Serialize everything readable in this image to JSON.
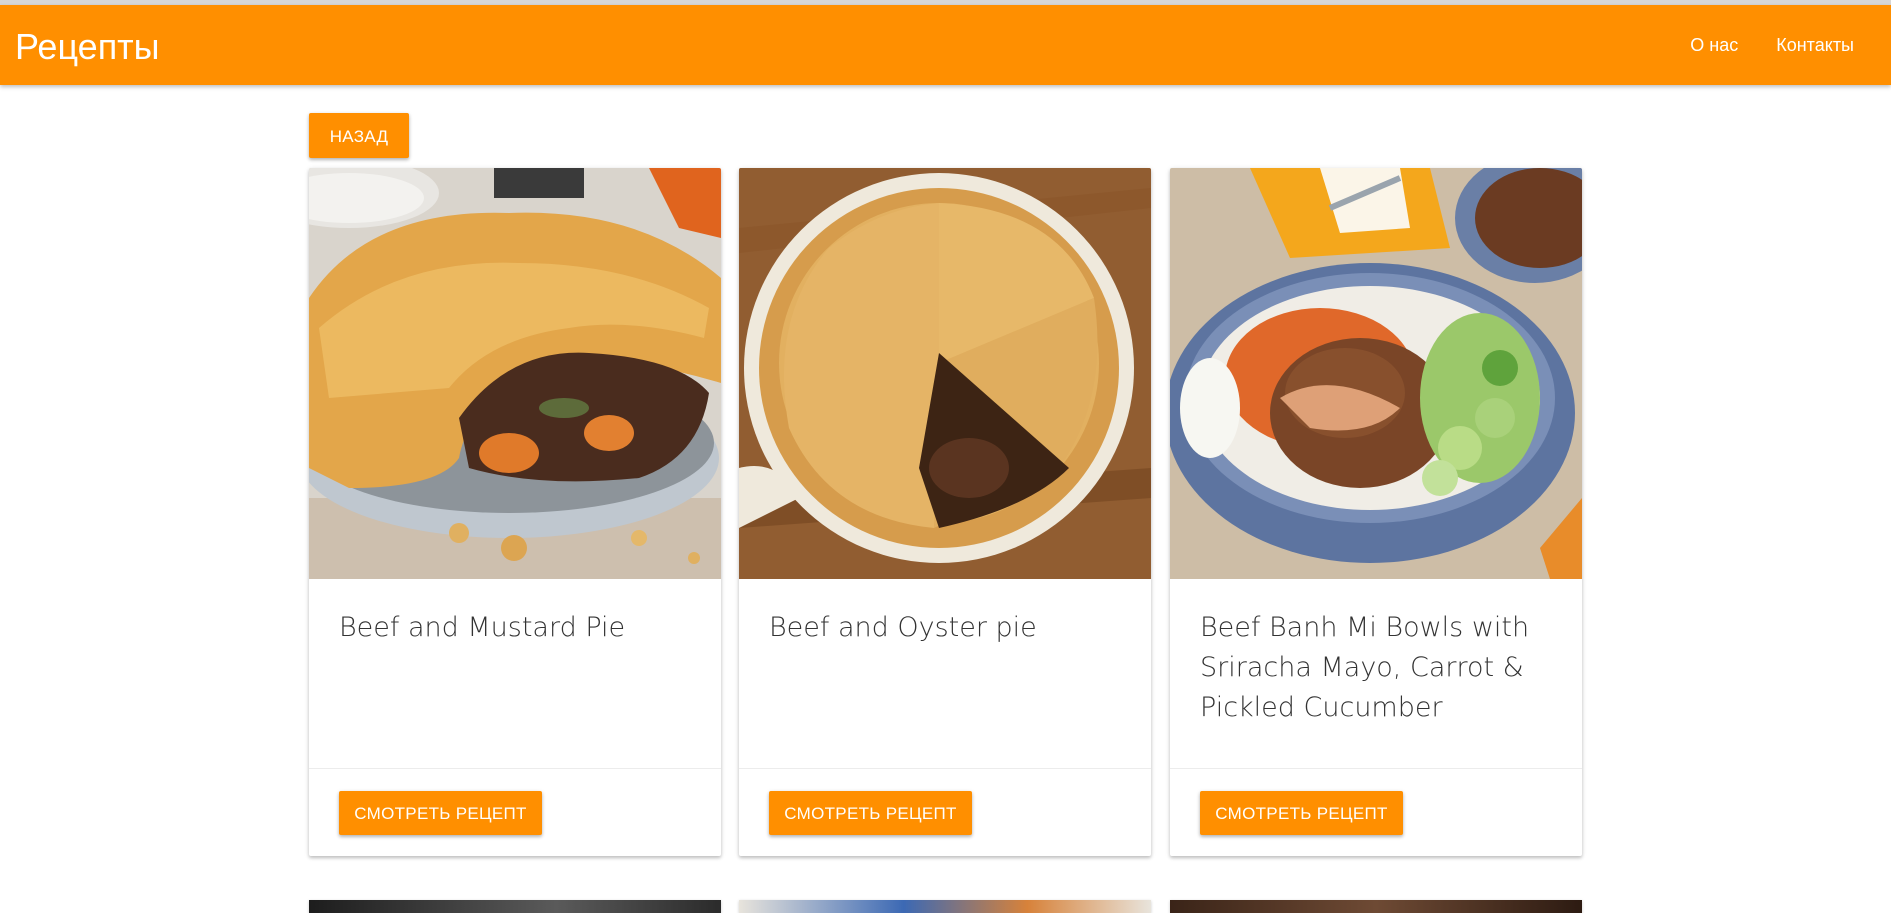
{
  "navbar": {
    "brand": "Рецепты",
    "links": [
      {
        "label": "О нас"
      },
      {
        "label": "Контакты"
      }
    ],
    "color": "#ff8f00"
  },
  "back_button": {
    "label": "Назад"
  },
  "cards": [
    {
      "title": "Beef and Mustard Pie",
      "button": "Смотреть рецепт",
      "image": "beef-and-mustard-pie-photo"
    },
    {
      "title": "Beef and Oyster pie",
      "button": "Смотреть рецепт",
      "image": "beef-and-oyster-pie-photo"
    },
    {
      "title": "Beef Banh Mi Bowls with Sriracha Mayo, Carrot & Pickled Cucumber",
      "button": "Смотреть рецепт",
      "image": "beef-banh-mi-bowl-photo"
    }
  ]
}
